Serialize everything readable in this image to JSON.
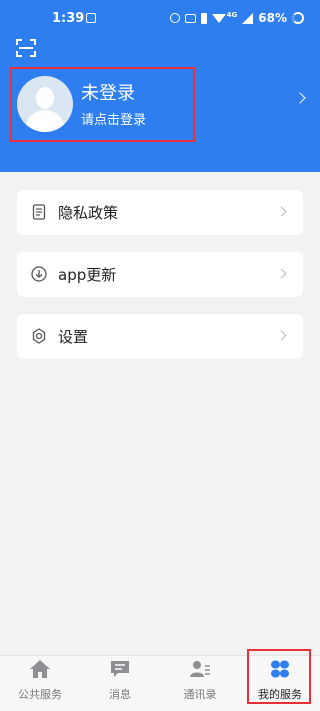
{
  "status_bar": {
    "time": "1:39",
    "battery": "68%",
    "network": "4G"
  },
  "profile": {
    "name": "未登录",
    "subtitle": "请点击登录"
  },
  "menu": [
    {
      "label": "隐私政策",
      "icon": "document-icon"
    },
    {
      "label": "app更新",
      "icon": "download-icon"
    },
    {
      "label": "设置",
      "icon": "gear-icon"
    }
  ],
  "tabs": [
    {
      "label": "公共服务",
      "icon": "home-icon"
    },
    {
      "label": "消息",
      "icon": "message-icon"
    },
    {
      "label": "通讯录",
      "icon": "contacts-icon"
    },
    {
      "label": "我的服务",
      "icon": "my-services-icon",
      "active": true
    }
  ],
  "colors": {
    "header": "#2f7ef0",
    "highlight": "#e8303a",
    "tab_active": "#2f7ef0"
  }
}
